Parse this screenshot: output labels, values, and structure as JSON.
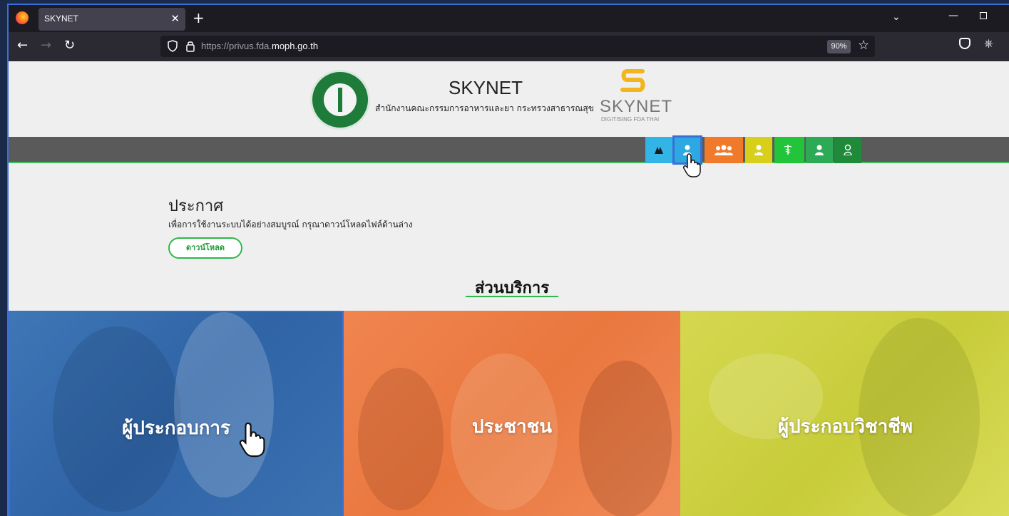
{
  "browser": {
    "tab_title": "SKYNET",
    "tab_close": "✕",
    "new_tab": "+",
    "url_prefix": "https://privus.fda.",
    "url_domain": "moph.go.th",
    "zoom": "90%"
  },
  "header": {
    "title": "SKYNET",
    "subtitle": "สำนักงานคณะกรรมการอาหารและยา กระทรวงสาธารณสุข",
    "logo_name": "SKYNET",
    "logo_tagline": "DIGITISING FDA THAI"
  },
  "menu": {
    "buttons": [
      {
        "icon": "fda-logo-icon",
        "color": "#33b4e6"
      },
      {
        "icon": "user-icon",
        "color": "#2ea8e0",
        "selected": true
      },
      {
        "icon": "people-group-icon",
        "color": "#f07a2a"
      },
      {
        "icon": "doctor-icon",
        "color": "#d7cf1a"
      },
      {
        "icon": "caduceus-icon",
        "color": "#22c43a"
      },
      {
        "icon": "officer-icon",
        "color": "#2daa55"
      },
      {
        "icon": "admin-icon",
        "color": "#1f8a3a"
      }
    ]
  },
  "announcement": {
    "title": "ประกาศ",
    "text": "เพื่อการใช้งานระบบได้อย่างสมบูรณ์ กรุณาดาวน์โหลดไฟล์ด้านล่าง",
    "download_label": "ดาวน์โหลด"
  },
  "services": {
    "title": "ส่วนบริการ",
    "tiles": [
      {
        "label": "ผู้ประกอบการ",
        "color": "#3a70b2"
      },
      {
        "label": "ประชาชน",
        "color": "#ee7f47"
      },
      {
        "label": "ผู้ประกอบวิชาชีพ",
        "color": "#cfd246"
      }
    ]
  }
}
